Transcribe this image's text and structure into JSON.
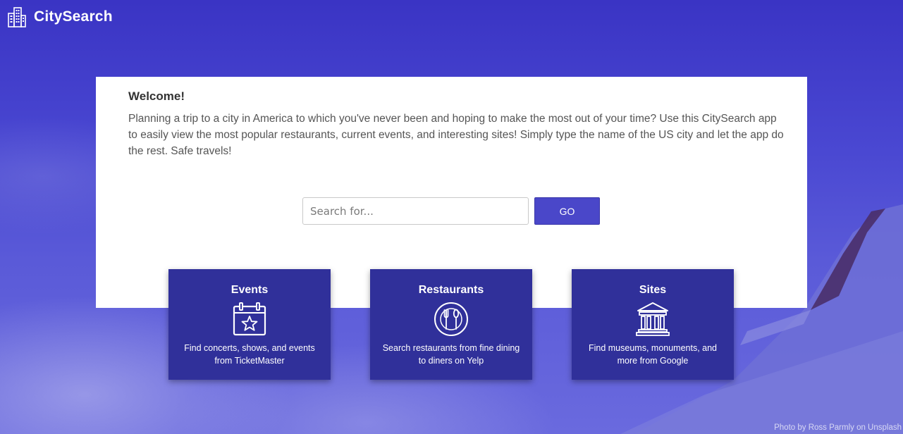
{
  "brand": {
    "name": "CitySearch",
    "icon": "city-buildings-icon"
  },
  "welcome": {
    "title": "Welcome!",
    "text": "Planning a trip to a city in America to which you've never been and hoping to make the most out of your time? Use this CitySearch app to easily view the most popular restaurants, current events, and interesting sites! Simply type the name of the US city and let the app do the rest. Safe travels!"
  },
  "search": {
    "placeholder": "Search for...",
    "value": "",
    "button_label": "GO"
  },
  "cards": [
    {
      "title": "Events",
      "icon": "calendar-star-icon",
      "description": "Find concerts, shows, and events from TicketMaster"
    },
    {
      "title": "Restaurants",
      "icon": "plate-fork-spoon-icon",
      "description": "Search restaurants from fine dining to diners on Yelp"
    },
    {
      "title": "Sites",
      "icon": "museum-building-icon",
      "description": "Find museums, monuments, and more from Google"
    }
  ],
  "footer": {
    "photo_credit": "Photo by Ross Parmly on Unsplash"
  },
  "colors": {
    "background": "#4a48d2",
    "card": "#30309a",
    "button": "#4a47c9",
    "card_text": "#ffffff"
  }
}
